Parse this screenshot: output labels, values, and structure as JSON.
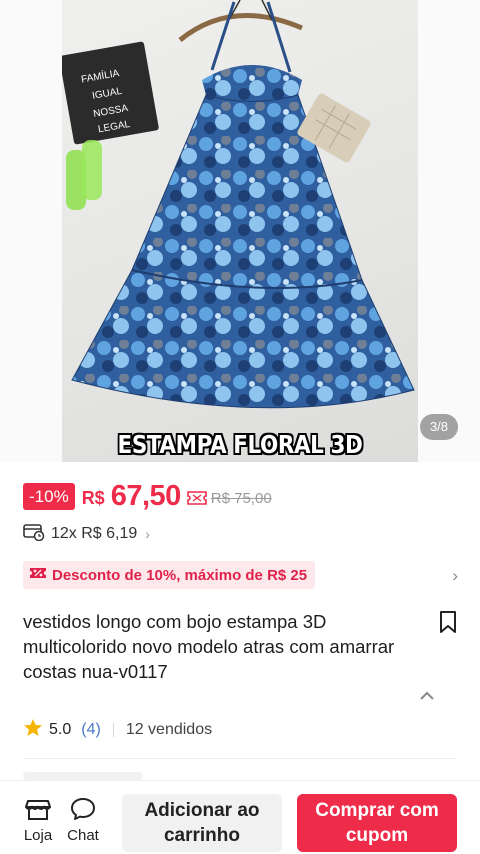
{
  "gallery": {
    "caption": "ESTAMPA FLORAL 3D",
    "counter": "3/8",
    "sign_lines": [
      "FAMÍLIA",
      "IGUAL",
      "NOSSA",
      "LEGAL"
    ]
  },
  "price": {
    "discount_badge": "-10%",
    "currency": "R$",
    "value": "67,50",
    "original": "R$ 75,00",
    "coupon_icon": "coupon-icon"
  },
  "installments": {
    "icon": "card-clock-icon",
    "text": "12x R$ 6,19",
    "chevron": "›"
  },
  "promo": {
    "icon": "discount-tag-icon",
    "text": "Desconto de 10%, máximo de R$ 25",
    "chevron": "›"
  },
  "product": {
    "title": "vestidos longo  com bojo estampa 3D multicolorido novo modelo atras com amarrar costas nua-v0117"
  },
  "rating": {
    "score": "5.0",
    "count": "(4)",
    "sold": "12 vendidos",
    "star_color": "#f5b400"
  },
  "bottom_bar": {
    "store_label": "Loja",
    "chat_label": "Chat",
    "add_to_cart": "Adicionar ao carrinho",
    "buy_with_coupon": "Comprar com cupom"
  },
  "colors": {
    "accent": "#ee2c4a",
    "promo_bg": "#fde9ec",
    "link": "#4a7ac9"
  }
}
